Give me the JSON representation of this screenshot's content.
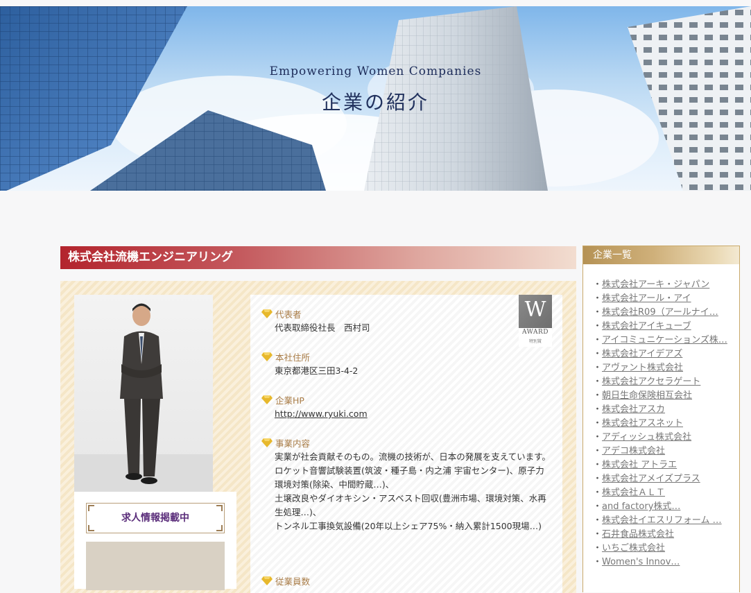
{
  "hero": {
    "subtitle_en": "Empowering Women Companies",
    "title_jp": "企業の紹介"
  },
  "company": {
    "name": "株式会社流機エンジニアリング",
    "recruit_label": "求人情報掲載中",
    "award": {
      "letter": "W",
      "label": "AWARD",
      "sub": "特別賞"
    },
    "info": [
      {
        "heading": "代表者",
        "lines": [
          "代表取締役社長　西村司"
        ]
      },
      {
        "heading": "本社住所",
        "lines": [
          "東京都港区三田3-4-2"
        ]
      },
      {
        "heading": "企業HP",
        "link": "http://www.ryuki.com"
      },
      {
        "heading": "事業内容",
        "lines": [
          "実業が社会貢献そのもの。流機の技術が、日本の発展を支えています。",
          "ロケット音響試験装置(筑波・種子島・内之浦 宇宙センター)、原子力環境対策(除染、中間貯蔵…)、",
          "土壌改良やダイオキシン・アスベスト回収(豊洲市場、環境対策、水再生処理…)、",
          "トンネル工事換気設備(20年以上シェア75%・納入累計1500現場…)"
        ]
      },
      {
        "heading": "従業員数"
      }
    ]
  },
  "sidebar": {
    "title": "企業一覧",
    "bullet": "・",
    "items": [
      "株式会社アーキ・ジャパン",
      "株式会社アール・アイ",
      "株式会社R09（アールナイ…",
      "株式会社アイキューブ",
      "アイコミュニケーションズ株…",
      "株式会社アイデアズ",
      "アヴァント株式会社",
      "株式会社アクセラゲート",
      "朝日生命保険相互会社",
      "株式会社アスカ",
      "株式会社アスネット",
      "アディッシュ株式会社",
      "アデコ株式会社",
      "株式会社 アトラエ",
      "株式会社アメイズプラス",
      "株式会社ＡＬＴ",
      "and factory株式…",
      "株式会社イエスリフォーム …",
      "石井食品株式会社",
      "いちご株式会社",
      "Women's Innov…"
    ]
  }
}
